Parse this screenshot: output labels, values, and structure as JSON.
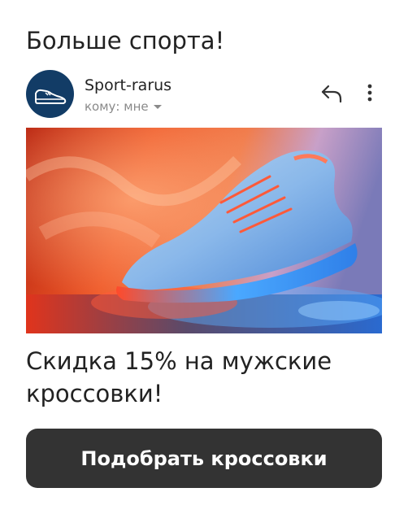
{
  "email": {
    "subject": "Больше спорта!",
    "sender": {
      "name": "Sport-rarus",
      "recipient_label": "кому: мне",
      "avatar_icon": "sneaker-icon",
      "avatar_color": "#123c66"
    },
    "actions": {
      "reply_icon": "reply-icon",
      "more_icon": "more-vertical-icon"
    },
    "hero_image": {
      "subject": "running-sneaker-photo",
      "colors": [
        "#e8472b",
        "#3d8fe0"
      ]
    },
    "offer_text": "Скидка 15% на мужские кроссовки!",
    "cta_label": "Подобрать кроссовки",
    "cta_color": "#333333"
  }
}
